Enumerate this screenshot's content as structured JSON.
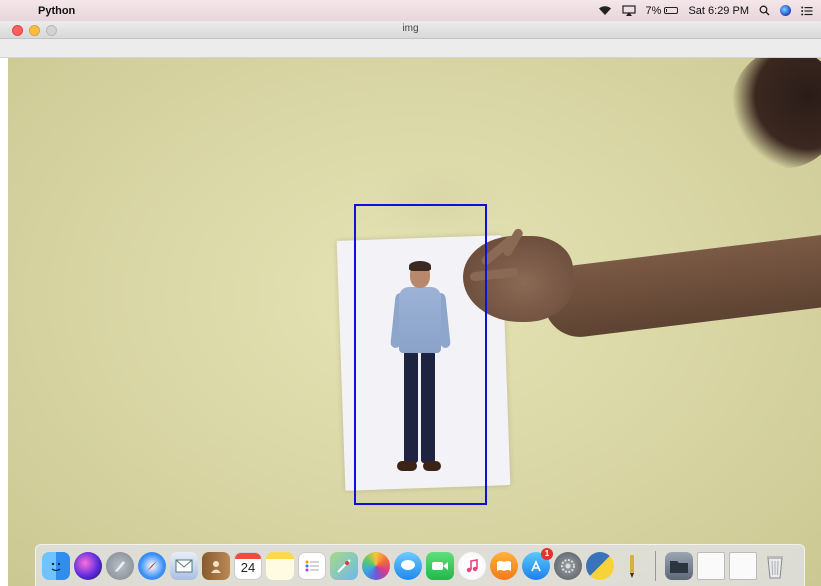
{
  "menubar": {
    "apple_glyph": "",
    "app_name": "Python",
    "battery_percent": "7%",
    "battery_level": 0.07,
    "clock": "Sat 6:29 PM",
    "icons": [
      "wifi-icon",
      "airplay-icon",
      "battery-icon",
      "spotlight-search-icon",
      "siri-icon",
      "notification-center-icon"
    ]
  },
  "window": {
    "title": "img"
  },
  "detection": {
    "box_color": "#1010d8"
  },
  "dock": {
    "calendar_day": "24",
    "appstore_badge": "1",
    "apps": [
      "finder",
      "siri",
      "launchpad",
      "safari",
      "mail",
      "contacts",
      "calendar",
      "notes",
      "reminders",
      "maps",
      "photos",
      "messages",
      "facetime",
      "itunes",
      "ibooks",
      "app-store",
      "system-preferences",
      "python-launcher",
      "pencil-tool",
      "folder",
      "document",
      "document",
      "trash"
    ]
  },
  "colors": {
    "menubar_bg": "#f4e6ea",
    "wall": "#dbd8a7"
  }
}
